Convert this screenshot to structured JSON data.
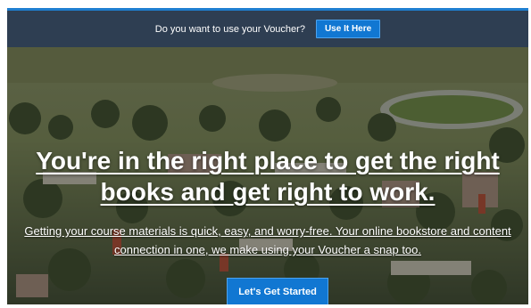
{
  "voucher_bar": {
    "prompt": "Do you want to use your Voucher?",
    "button_label": "Use It Here"
  },
  "hero": {
    "headline": "You're in the right place to get the right books and get right to work.",
    "subcopy": "Getting your course materials is quick, easy, and worry-free. Your online bookstore and content connection in one, we make using your Voucher a snap too.",
    "cta_label": "Let's Get Started",
    "background_image": "aerial-campus-photo"
  },
  "colors": {
    "accent_blue": "#1177d2",
    "bar_background": "#2e3e52",
    "top_rule": "#1f7fd0",
    "text_on_dark": "#ffffff"
  }
}
